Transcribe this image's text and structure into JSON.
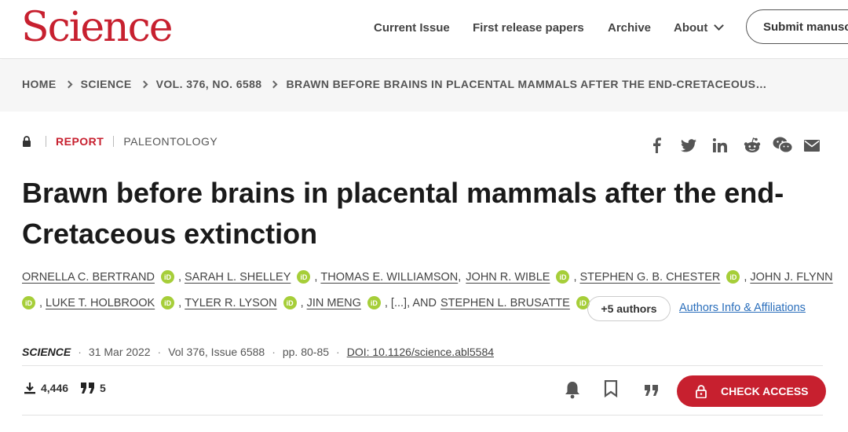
{
  "header": {
    "logo": "Science",
    "nav": {
      "current_issue": "Current Issue",
      "first_release": "First release papers",
      "archive": "Archive",
      "about": "About"
    },
    "submit_label": "Submit manuscript"
  },
  "breadcrumb": [
    "HOME",
    "SCIENCE",
    "VOL. 376, NO. 6588",
    "BRAWN BEFORE BRAINS IN PLACENTAL MAMMALS AFTER THE END-CRETACEOUS…"
  ],
  "article": {
    "type": "REPORT",
    "topic": "PALEONTOLOGY",
    "title": "Brawn before brains in placental mammals after the end-Cretaceous extinction",
    "authors_line1": [
      "ORNELLA C. BERTRAND",
      "SARAH L. SHELLEY",
      "THOMAS E. WILLIAMSON",
      "JOHN R. WIBLE",
      "STEPHEN G. B. CHESTER",
      "JOHN J. FLYNN"
    ],
    "authors_line2": [
      "LUKE T. HOLBROOK",
      "TYLER R. LYSON",
      "JIN MENG"
    ],
    "ellipsis_text": "[...], AND",
    "last_author": "STEPHEN L. BRUSATTE",
    "comma": ",",
    "orcid_label": "iD",
    "more_authors": "+5 authors",
    "affiliations_link": "Authors Info & Affiliations",
    "journal": "SCIENCE",
    "date": "31 Mar 2022",
    "volume": "Vol 376, Issue 6588",
    "pages": "pp. 80-85",
    "doi": "DOI: 10.1126/science.abl5584",
    "separator": "·"
  },
  "metrics": {
    "downloads": "4,446",
    "citations": "5"
  },
  "access_button": "CHECK ACCESS",
  "colors": {
    "brand_red": "#c7202f",
    "orcid_green": "#a6ce39",
    "link_blue": "#2a6ebb"
  },
  "icons": [
    "lock-icon",
    "facebook-icon",
    "twitter-icon",
    "linkedin-icon",
    "reddit-icon",
    "wechat-icon",
    "email-icon",
    "download-icon",
    "quote-icon",
    "bell-icon",
    "bookmark-icon",
    "cite-icon"
  ]
}
